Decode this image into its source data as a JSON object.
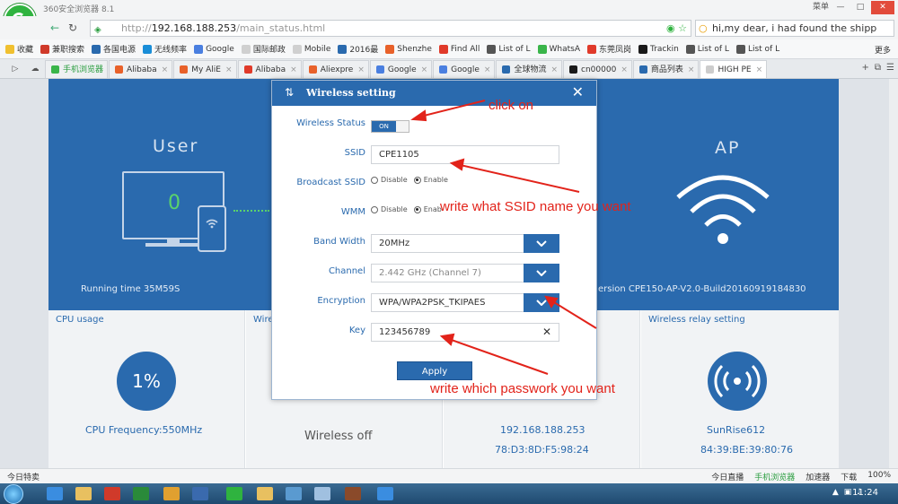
{
  "browser": {
    "title": "360安全浏览器 8.1",
    "window_controls": [
      "菜单",
      "—",
      "□",
      "✕"
    ],
    "url_prefix": "http://",
    "url_host": "192.168.188.253",
    "url_path": "/main_status.html",
    "search_value": "hi,my dear, i had found the shipp "
  },
  "bookmarks": [
    {
      "label": "收藏",
      "color": "#f0c030"
    },
    {
      "label": "兼职搜索",
      "color": "#d03a2a"
    },
    {
      "label": "各国电源",
      "color": "#2a6aae"
    },
    {
      "label": "无线频率",
      "color": "#1a8ed8"
    },
    {
      "label": "Google",
      "color": "#4a7fe0"
    },
    {
      "label": "国际邮政",
      "color": "#d0d0d0"
    },
    {
      "label": "Mobile",
      "color": "#d0d0d0"
    },
    {
      "label": "2016最",
      "color": "#2a6aae"
    },
    {
      "label": "Shenzhe",
      "color": "#e8612a"
    },
    {
      "label": "Find All",
      "color": "#e03a2a"
    },
    {
      "label": "List of L",
      "color": "#555555"
    },
    {
      "label": "WhatsA",
      "color": "#3ab54a"
    },
    {
      "label": "东莞凤岗",
      "color": "#e03a2a"
    },
    {
      "label": "Trackin",
      "color": "#1a1a1a"
    },
    {
      "label": "List of L",
      "color": "#555555"
    },
    {
      "label": "List of L",
      "color": "#555555"
    }
  ],
  "bookmarks_more": "更多",
  "tabs": [
    {
      "label": "手机浏览器",
      "color": "#3ab54a",
      "green": true,
      "active": false
    },
    {
      "label": "Alibaba",
      "color": "#e8612a",
      "green": false,
      "active": false
    },
    {
      "label": "My AliE",
      "color": "#e8612a",
      "green": false,
      "active": false
    },
    {
      "label": "Alibaba",
      "color": "#e03a2a",
      "green": false,
      "active": false
    },
    {
      "label": "Aliexpre",
      "color": "#e8612a",
      "green": false,
      "active": false
    },
    {
      "label": "Google",
      "color": "#4a7fe0",
      "green": false,
      "active": false
    },
    {
      "label": "Google",
      "color": "#4a7fe0",
      "green": false,
      "active": false
    },
    {
      "label": "全球物流",
      "color": "#2a6aae",
      "green": false,
      "active": false
    },
    {
      "label": "cn00000",
      "color": "#1a1a1a",
      "green": false,
      "active": false
    },
    {
      "label": "商品列表",
      "color": "#2a6aae",
      "green": false,
      "active": false
    },
    {
      "label": "HIGH PE",
      "color": "#cccccc",
      "green": false,
      "active": true
    }
  ],
  "dashboard": {
    "user_label": "User",
    "ap_label": "AP",
    "user_count": "0",
    "running_time": "Running time  35M59S",
    "version": "ersion   CPE150-AP-V2.0-Build20160919184830",
    "cards": [
      {
        "title": "CPU usage",
        "value": "1%",
        "line1": "CPU Frequency:550MHz",
        "line2": ""
      },
      {
        "title": "Wire",
        "value": "",
        "line1": "Wireless off",
        "line2": ""
      },
      {
        "title": "",
        "value": "",
        "line1": "192.168.188.253",
        "line2": "78:D3:8D:F5:98:24"
      },
      {
        "title": "Wireless relay setting",
        "value": "",
        "line1": "SunRise612",
        "line2": "84:39:BE:39:80:76"
      }
    ]
  },
  "modal": {
    "title": "Wireless setting",
    "close": "✕",
    "wireless_status_label": "Wireless Status",
    "toggle_on": "ON",
    "ssid_label": "SSID",
    "ssid_value": "CPE1105",
    "broadcast_label": "Broadcast SSID",
    "wmm_label": "WMM",
    "disable": "Disable",
    "enable": "Enable",
    "wmm_enable_cut": "Enab",
    "band_label": "Band Width",
    "band_value": "20MHz",
    "channel_label": "Channel",
    "channel_value": "2.442 GHz (Channel 7)",
    "encryption_label": "Encryption",
    "encryption_value": "WPA/WPA2PSK_TKIPAES",
    "key_label": "Key",
    "key_value": "123456789",
    "apply": "Apply"
  },
  "annotations": {
    "click_on": "click on",
    "ssid_hint": "write what SSID name you want",
    "password_hint": "write which passwork you want"
  },
  "statusbar": {
    "left": "今日特卖",
    "items": [
      "今日直播",
      "手机浏览器",
      "加速器",
      "下载",
      "100%"
    ]
  },
  "taskbar": {
    "clock": "11:24"
  },
  "colors": {
    "brand_blue": "#2a6aae",
    "annotation_red": "#e2231a",
    "browser_green": "#2fb33f"
  }
}
